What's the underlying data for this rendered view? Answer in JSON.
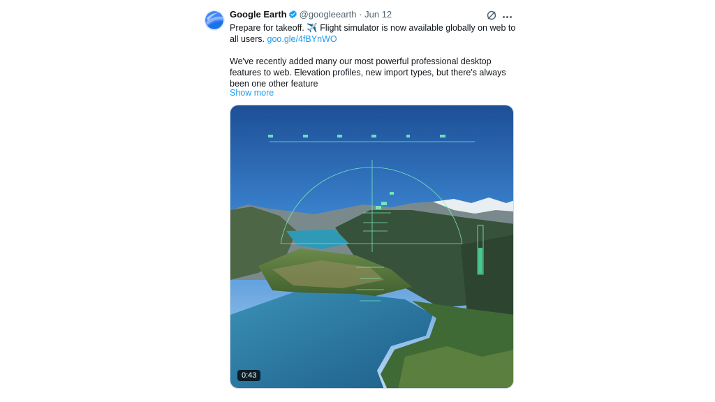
{
  "tweet": {
    "author_name": "Google Earth",
    "handle": "@googleearth",
    "separator": "·",
    "date": "Jun 12",
    "line1": "Prepare for takeoff. ✈️ Flight simulator is now available globally on web to",
    "line2_prefix": "all users. ",
    "link": "goo.gle/4fBYnWO",
    "para2_line1": "We've recently added many our most powerful professional desktop",
    "para2_line2": "features to web. Elevation profiles, new import types, but there's always",
    "para2_line3": "been one other feature",
    "show_more": "Show more"
  },
  "media": {
    "duration": "0:43"
  },
  "icons": {
    "avatar": "google-earth-logo",
    "verified": "verified-badge-icon",
    "grok": "grok-icon",
    "more": "more-options-icon"
  },
  "colors": {
    "link": "#1d9bf0",
    "verified": "#1d9bf0",
    "hud": "#7cf5c0"
  }
}
